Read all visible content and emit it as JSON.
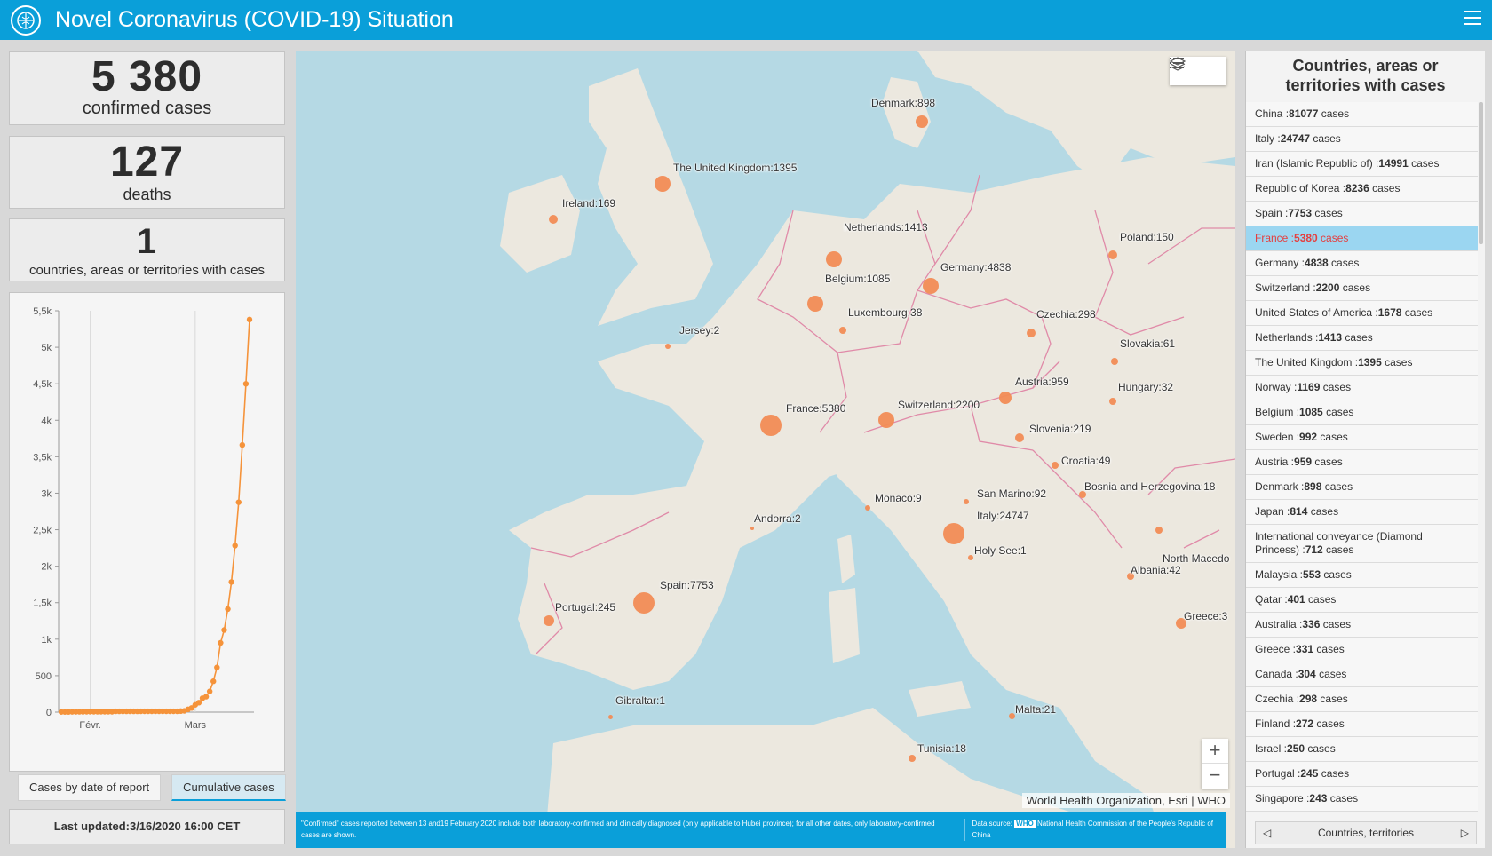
{
  "header": {
    "title": "Novel Coronavirus (COVID-19) Situation",
    "logo_icon": "who-emblem-icon",
    "menu_icon": "hamburger-menu-icon"
  },
  "stats": {
    "confirmed": {
      "value": "5 380",
      "label": "confirmed cases"
    },
    "deaths": {
      "value": "127",
      "label": "deaths"
    },
    "countries": {
      "value": "1",
      "label": "countries, areas or territories with cases"
    }
  },
  "chart_data": {
    "type": "line",
    "x_tick_labels": [
      "Févr.",
      "Mars"
    ],
    "y_tick_labels": [
      "0",
      "500",
      "1k",
      "1,5k",
      "2k",
      "2,5k",
      "3k",
      "3,5k",
      "4k",
      "4,5k",
      "5k",
      "5,5k"
    ],
    "ylim": [
      0,
      5500
    ],
    "grid": true,
    "series": [
      {
        "x": [
          "2020-01-24",
          "2020-01-25",
          "2020-01-26",
          "2020-01-27",
          "2020-01-28",
          "2020-01-29",
          "2020-01-30",
          "2020-01-31",
          "2020-02-01",
          "2020-02-02",
          "2020-02-03",
          "2020-02-04",
          "2020-02-05",
          "2020-02-06",
          "2020-02-07",
          "2020-02-08",
          "2020-02-09",
          "2020-02-10",
          "2020-02-11",
          "2020-02-12",
          "2020-02-13",
          "2020-02-14",
          "2020-02-15",
          "2020-02-16",
          "2020-02-17",
          "2020-02-18",
          "2020-02-19",
          "2020-02-20",
          "2020-02-21",
          "2020-02-22",
          "2020-02-23",
          "2020-02-24",
          "2020-02-25",
          "2020-02-26",
          "2020-02-27",
          "2020-02-28",
          "2020-02-29",
          "2020-03-01",
          "2020-03-02",
          "2020-03-03",
          "2020-03-04",
          "2020-03-05",
          "2020-03-06",
          "2020-03-07",
          "2020-03-08",
          "2020-03-09",
          "2020-03-10",
          "2020-03-11",
          "2020-03-12",
          "2020-03-13",
          "2020-03-14",
          "2020-03-15",
          "2020-03-16"
        ],
        "values": [
          3,
          3,
          3,
          4,
          4,
          5,
          5,
          6,
          6,
          6,
          6,
          6,
          6,
          6,
          6,
          11,
          11,
          11,
          11,
          11,
          11,
          11,
          12,
          12,
          12,
          12,
          12,
          12,
          12,
          12,
          12,
          12,
          12,
          14,
          18,
          38,
          57,
          100,
          130,
          191,
          212,
          285,
          423,
          613,
          949,
          1126,
          1412,
          1784,
          2281,
          2876,
          3661,
          4499,
          5380
        ],
        "color": "#f5933a"
      }
    ]
  },
  "chart_tabs": [
    "Cases by date of report",
    "Cumulative cases"
  ],
  "last_updated": "Last updated:3/16/2020 16:00 CET",
  "map": {
    "attribution": "World Health Organization, Esri | WHO",
    "note_left": "\"Confirmed\" cases reported between 13 and19 February 2020 include both laboratory-confirmed and clinically diagnosed (only  applicable to Hubei province); for all other dates, only laboratory-confirmed cases are shown.",
    "note_right_prefix": "Data source:",
    "note_right_tag": "WHO",
    "note_right_rest": "National Health Commission of the People's Republic of China",
    "tools": [
      "legend-list-icon",
      "layers-icon"
    ],
    "zoom_in": "+",
    "zoom_out": "−",
    "labels": [
      "Denmark:898",
      "The United Kingdom:1395",
      "Ireland:169",
      "Netherlands:1413",
      "Poland:150",
      "Germany:4838",
      "Belgium:1085",
      "Luxembourg:38",
      "Czechia:298",
      "Jersey:2",
      "Slovakia:61",
      "Austria:959",
      "Hungary:32",
      "France:5380",
      "Switzerland:2200",
      "Slovenia:219",
      "Croatia:49",
      "San Marino:92",
      "Bosnia and Herzegovina:18",
      "Monaco:9",
      "Italy:24747",
      "Andorra:2",
      "Holy See:1",
      "North Macedo",
      "Albania:42",
      "Spain:7753",
      "Portugal:245",
      "Greece:3",
      "Gibraltar:1",
      "Malta:21",
      "Tunisia:18"
    ]
  },
  "sidebar": {
    "title": "Countries, areas or territories with cases",
    "suffix": " cases",
    "items": [
      {
        "name": "China :",
        "count": "81077"
      },
      {
        "name": "Italy :",
        "count": "24747"
      },
      {
        "name": "Iran (Islamic Republic of) :",
        "count": "14991"
      },
      {
        "name": "Republic of Korea :",
        "count": "8236"
      },
      {
        "name": "Spain :",
        "count": "7753"
      },
      {
        "name": "France :",
        "count": "5380"
      },
      {
        "name": "Germany :",
        "count": "4838"
      },
      {
        "name": "Switzerland :",
        "count": "2200"
      },
      {
        "name": "United States of America :",
        "count": "1678"
      },
      {
        "name": "Netherlands :",
        "count": "1413"
      },
      {
        "name": "The United Kingdom :",
        "count": "1395"
      },
      {
        "name": "Norway :",
        "count": "1169"
      },
      {
        "name": "Belgium :",
        "count": "1085"
      },
      {
        "name": "Sweden :",
        "count": "992"
      },
      {
        "name": "Austria :",
        "count": "959"
      },
      {
        "name": "Denmark :",
        "count": "898"
      },
      {
        "name": "Japan :",
        "count": "814"
      },
      {
        "name": "International conveyance (Diamond Princess) :",
        "count": "712"
      },
      {
        "name": "Malaysia :",
        "count": "553"
      },
      {
        "name": "Qatar :",
        "count": "401"
      },
      {
        "name": "Australia :",
        "count": "336"
      },
      {
        "name": "Greece :",
        "count": "331"
      },
      {
        "name": "Canada :",
        "count": "304"
      },
      {
        "name": "Czechia :",
        "count": "298"
      },
      {
        "name": "Finland :",
        "count": "272"
      },
      {
        "name": "Israel :",
        "count": "250"
      },
      {
        "name": "Portugal :",
        "count": "245"
      },
      {
        "name": "Singapore :",
        "count": "243"
      }
    ],
    "footer": "Countries, territories",
    "prev_icon": "chevron-left-icon",
    "next_icon": "chevron-right-icon"
  }
}
